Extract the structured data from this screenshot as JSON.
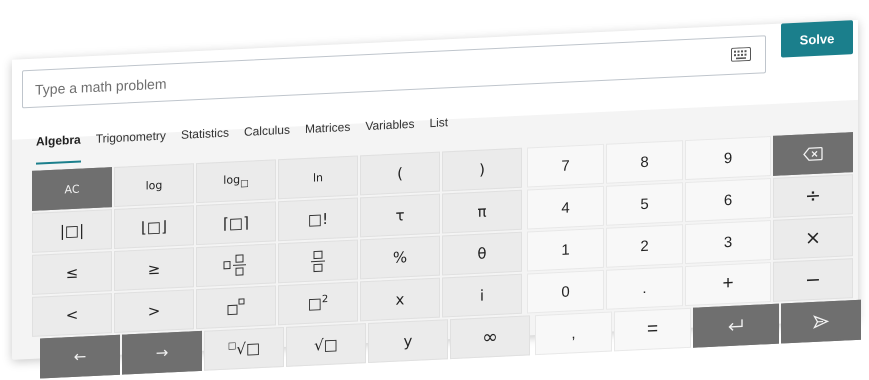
{
  "search": {
    "placeholder": "Type a math problem",
    "keyboard_icon": "keyboard-icon"
  },
  "solve_label": "Solve",
  "tabs": [
    "Algebra",
    "Trigonometry",
    "Statistics",
    "Calculus",
    "Matrices",
    "Variables",
    "List"
  ],
  "active_tab": "Algebra",
  "keys": {
    "ac": "AC",
    "log": "log",
    "log_base": "log□",
    "ln": "ln",
    "lparen": "(",
    "rparen": ")",
    "abs": "|□|",
    "floor": "⌊□⌋",
    "ceil": "⌈□⌉",
    "factorial": "□!",
    "tau": "τ",
    "pi": "π",
    "le": "≤",
    "ge": "≥",
    "mixed_fraction": "□□/□",
    "fraction": "□/□",
    "percent": "%",
    "theta": "θ",
    "lt": "<",
    "gt": ">",
    "power": "□□",
    "square": "□2",
    "x": "x",
    "i": "i",
    "left_arrow": "←",
    "right_arrow": "→",
    "nth_root": "□√□",
    "sqrt": "√□",
    "y": "y",
    "infinity": "∞",
    "n7": "7",
    "n8": "8",
    "n9": "9",
    "n4": "4",
    "n5": "5",
    "n6": "6",
    "n1": "1",
    "n2": "2",
    "n3": "3",
    "n0": "0",
    "dot": ".",
    "comma": ",",
    "equals": "=",
    "backspace_icon": "backspace-icon",
    "divide": "÷",
    "multiply": "×",
    "plus": "+",
    "minus": "−",
    "enter_icon": "enter-icon",
    "submit_icon": "submit-icon"
  },
  "colors": {
    "accent": "#1b7f8c",
    "dark_key": "#6f6f6f",
    "light_key": "#ebebeb",
    "num_key": "#f8f8f8"
  }
}
